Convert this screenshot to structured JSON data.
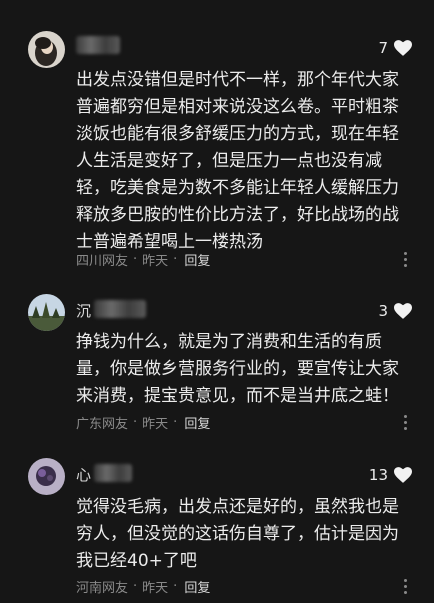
{
  "comments": [
    {
      "name_char": "",
      "likes": "7",
      "text": "出发点没错但是时代不一样，那个年代大家\n普遍都穷但是相对来说没这么卷。平时粗茶\n淡饭也能有很多舒缓压力的方式，现在年轻\n人生活是变好了，但是压力一点也没有减\n轻，吃美食是为数不多能让年轻人缓解压力\n释放多巴胺的性价比方法了，好比战场的战\n士普遍希望喝上一楼热汤",
      "location": "四川网友",
      "time": "昨天",
      "reply": "回复"
    },
    {
      "name_char": "沉",
      "likes": "3",
      "text": "挣钱为什么，就是为了消费和生活的有质\n量，你是做乡营服务行业的，要宣传让大家\n来消费，提宝贵意见，而不是当井底之蛙！",
      "location": "广东网友",
      "time": "昨天",
      "reply": "回复"
    },
    {
      "name_char": "心",
      "likes": "13",
      "text": "觉得没毛病，出发点还是好的，虽然我也是\n穷人，但没觉的这话伤自尊了，估计是因为\n我已经40+了吧",
      "location": "河南网友",
      "time": "昨天",
      "reply": "回复"
    }
  ],
  "icons": {
    "like": "heart-icon",
    "more": "more-vertical-icon"
  },
  "colors": {
    "background": "#161616",
    "text": "#ececec",
    "meta": "#8a8a8a"
  }
}
